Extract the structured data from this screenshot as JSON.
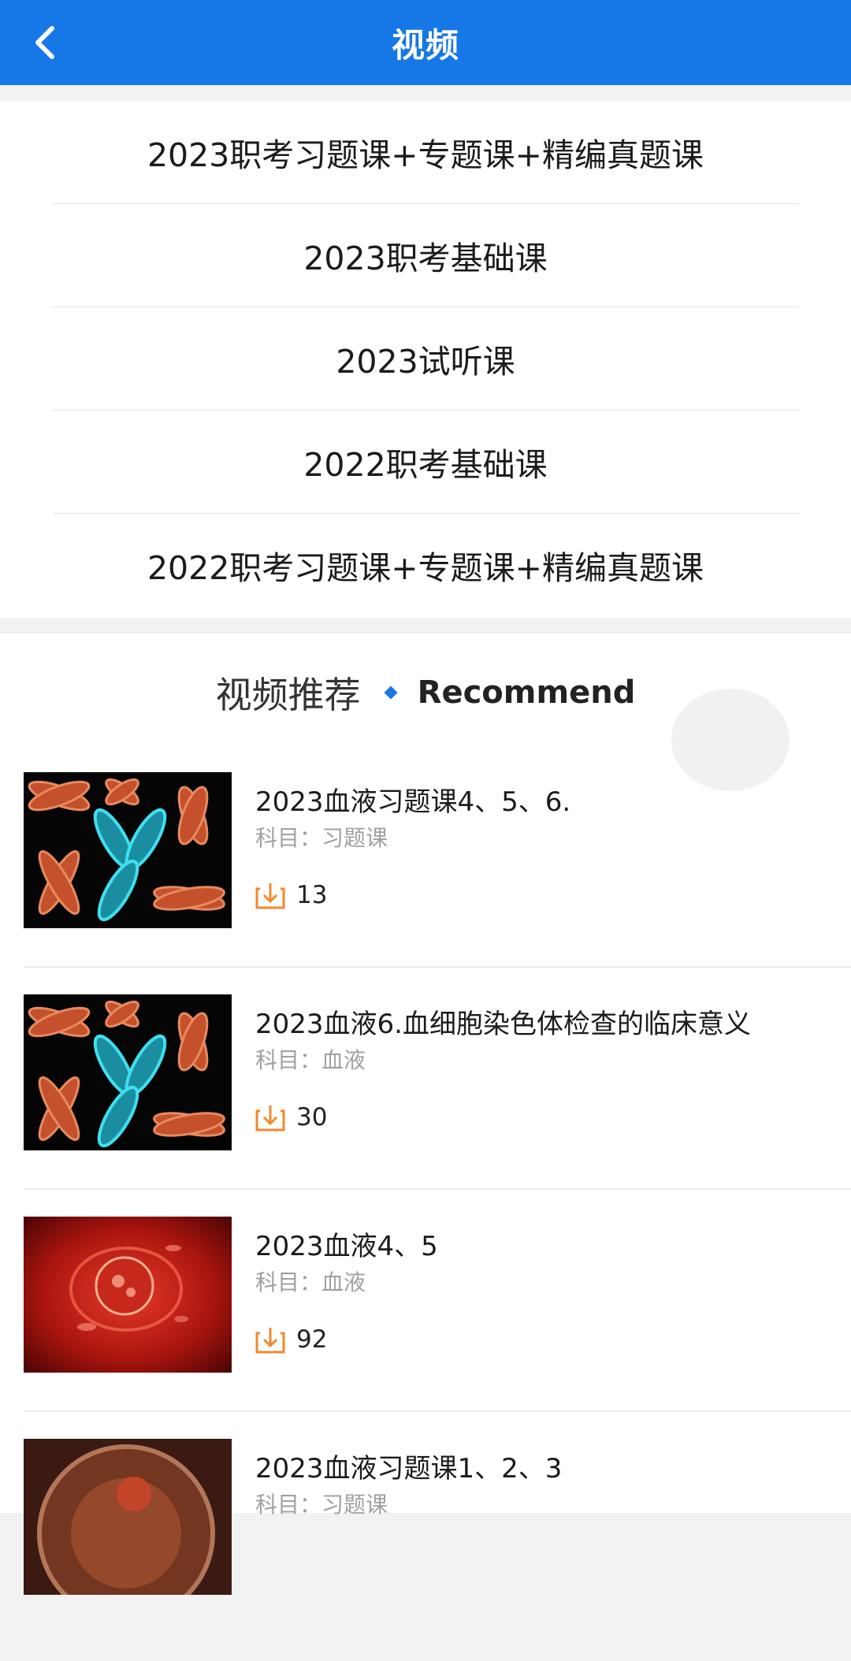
{
  "header": {
    "title": "视频",
    "back_icon": "chevron-left-icon"
  },
  "categories": [
    {
      "label": "2023职考习题课+专题课+精编真题课"
    },
    {
      "label": "2023职考基础课"
    },
    {
      "label": "2023试听课"
    },
    {
      "label": "2022职考基础课"
    },
    {
      "label": "2022职考习题课+专题课+精编真题课"
    }
  ],
  "recommend": {
    "title_cn": "视频推荐",
    "title_en": "Recommend",
    "items": [
      {
        "title": "2023血液习题课4、5、6.",
        "subject": "科目：习题课",
        "downloads": "13",
        "thumb": "chromosomes"
      },
      {
        "title": "2023血液6.血细胞染色体检查的临床意义",
        "subject": "科目：血液",
        "downloads": "30",
        "thumb": "chromosomes"
      },
      {
        "title": "2023血液4、5",
        "subject": "科目：血液",
        "downloads": "92",
        "thumb": "blood-vessel"
      },
      {
        "title": "2023血液习题课1、2、3",
        "subject": "科目：习题课",
        "downloads": "",
        "thumb": "cell"
      }
    ]
  },
  "colors": {
    "accent": "#1677e6",
    "download_icon": "#f08a2c"
  }
}
